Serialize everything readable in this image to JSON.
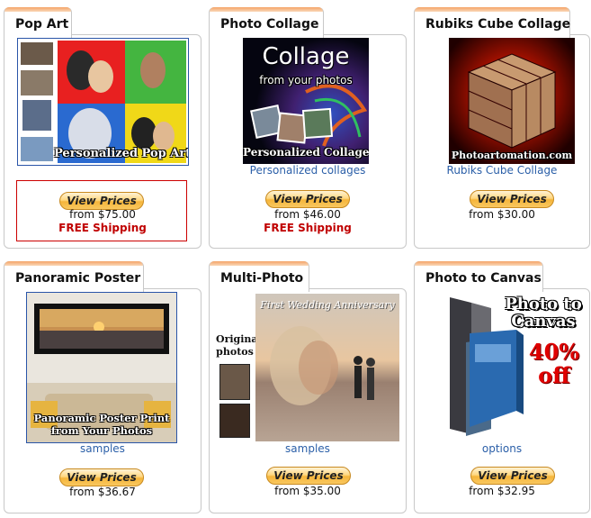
{
  "colors": {
    "tab_highlight": "#f4a366",
    "link": "#2b5fa8",
    "shipping": "#c00000",
    "button": "#f5b53a",
    "border": "#c8c8c8"
  },
  "products": [
    {
      "title": "Pop Art",
      "image_caption": "Personalized Pop Art",
      "link": "",
      "button": "View Prices",
      "price": "from $75.00",
      "shipping": "FREE Shipping"
    },
    {
      "title": "Photo Collage",
      "image_caption": "Personalized Collage",
      "image_title": "Collage",
      "image_subtitle": "from your photos",
      "link": "Personalized collages",
      "button": "View Prices",
      "price": "from $46.00",
      "shipping": "FREE Shipping"
    },
    {
      "title": "Rubiks Cube Collage",
      "image_caption": "Photoartomation.com",
      "link": "Rubiks Cube Collage",
      "button": "View Prices",
      "price": "from $30.00",
      "shipping": ""
    },
    {
      "title": "Panoramic Poster",
      "image_caption": "Panoramic Poster Print from Your Photos",
      "link": "samples",
      "button": "View Prices",
      "price": "from $36.67",
      "shipping": ""
    },
    {
      "title": "Multi-Photo",
      "image_title": "First Wedding Anniversary",
      "image_side_label": "Original photos",
      "link": "samples",
      "button": "View Prices",
      "price": "from $35.00",
      "shipping": ""
    },
    {
      "title": "Photo to Canvas",
      "image_title": "Photo to Canvas",
      "image_promo": "40% off",
      "link": "options",
      "button": "View Prices",
      "price": "from $32.95",
      "shipping": ""
    }
  ]
}
